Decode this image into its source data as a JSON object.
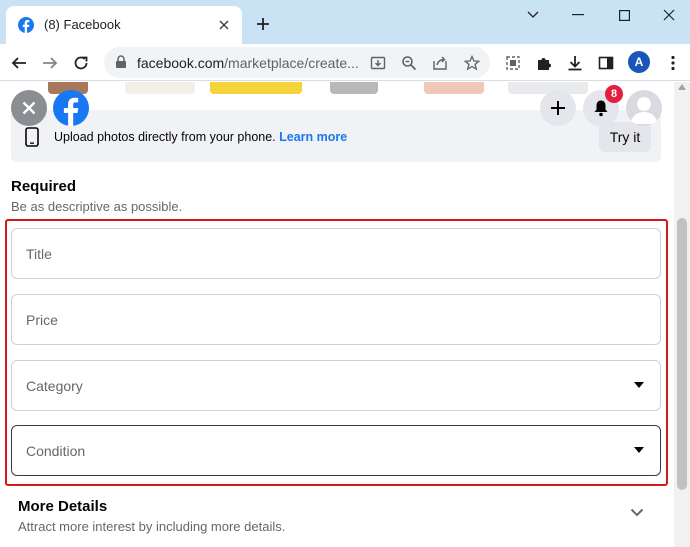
{
  "browser": {
    "tab_title": "(8) Facebook",
    "url_main": "facebook.com",
    "url_rest": "/marketplace/create...",
    "profile_initial": "A"
  },
  "header": {
    "notification_count": "8",
    "try_it_label": "Try it"
  },
  "upload_banner": {
    "text": "Upload photos directly from your phone.",
    "link": "Learn more"
  },
  "required": {
    "title": "Required",
    "subtitle": "Be as descriptive as possible.",
    "fields": {
      "title": "Title",
      "price": "Price",
      "category": "Category",
      "condition": "Condition"
    }
  },
  "more_details": {
    "title": "More Details",
    "subtitle": "Attract more interest by including more details."
  },
  "colors": {
    "facebook_blue": "#1877f2",
    "highlight_red": "#d11a1a",
    "chrome_frame": "#c9e3f5"
  }
}
